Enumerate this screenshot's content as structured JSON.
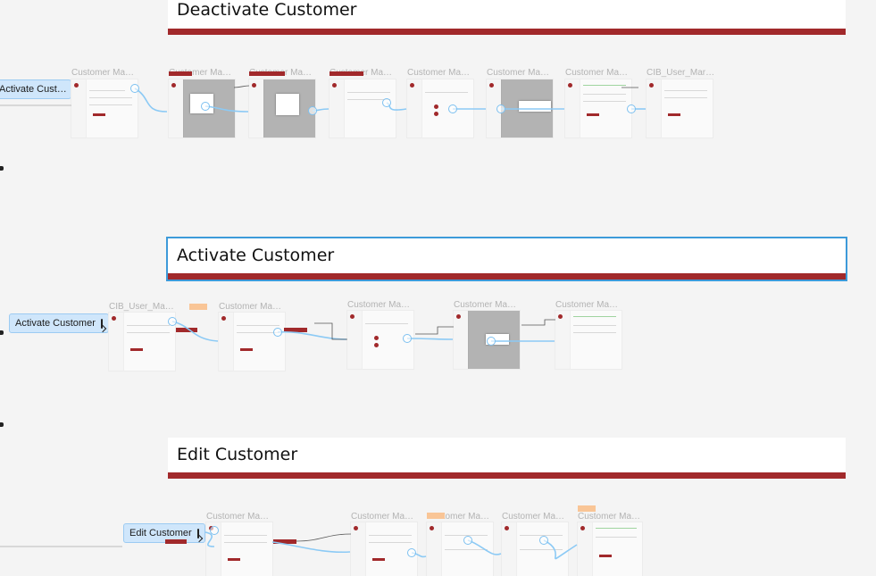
{
  "sections": [
    {
      "title": "Deactivate Customer",
      "selected": false
    },
    {
      "title": "Activate Customer",
      "selected": true
    },
    {
      "title": "Edit Customer",
      "selected": false
    }
  ],
  "flow_starts": [
    {
      "label": "Activate Cust…",
      "icon": "play-flow-icon"
    },
    {
      "label": "Activate Customer",
      "icon": "play-flow-icon"
    },
    {
      "label": "Edit Customer",
      "icon": "play-flow-icon"
    }
  ],
  "frames": {
    "row1": [
      "Customer Ma…",
      "Customer Ma…",
      "Customer Ma…",
      "Customer Ma…",
      "Customer Ma…",
      "Customer Ma…",
      "Customer Ma…",
      "CIB_User_Mar…"
    ],
    "row2": [
      "CIB_User_Ma…",
      "Customer Ma…",
      "Customer Ma…",
      "Customer Ma…",
      "Customer Ma…"
    ],
    "row3": [
      "Customer Ma…",
      "Customer Ma…",
      "Customer Ma…",
      "Customer Ma…",
      "Customer Ma…"
    ]
  },
  "colors": {
    "accent": "#a1292b",
    "wire": "#8ccaf5",
    "selection": "#3d9ad9",
    "note": "#f9c596"
  }
}
